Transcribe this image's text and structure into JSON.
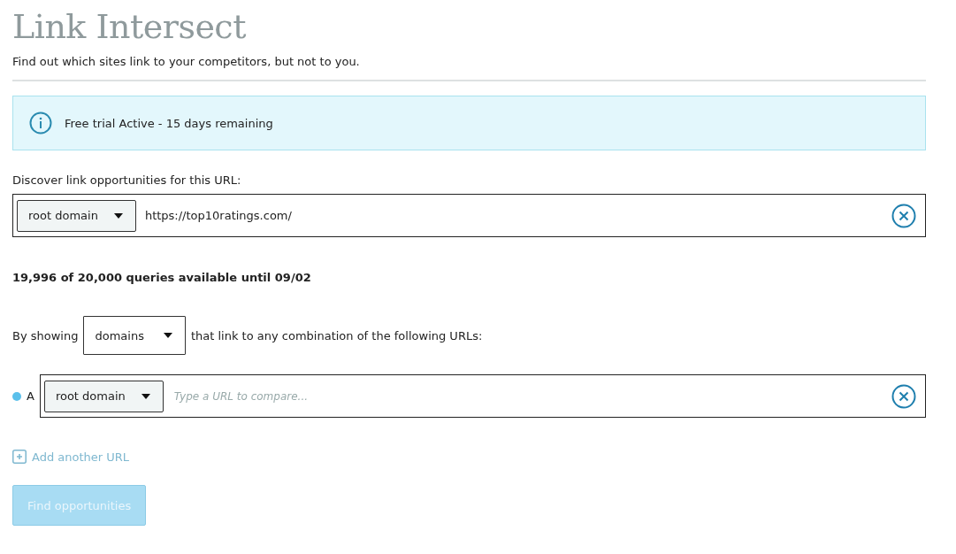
{
  "title": "Link Intersect",
  "subtitle": "Find out which sites link to your competitors, but not to you.",
  "alert": {
    "text": "Free trial Active - 15 days remaining"
  },
  "target": {
    "label": "Discover link opportunities for this URL:",
    "scope": "root domain",
    "value": "https://top10ratings.com/"
  },
  "quota": "19,996 of 20,000 queries available until 09/02",
  "showing": {
    "before": "By showing",
    "choice": "domains",
    "after": "that link to any combination of the following URLs:"
  },
  "competitors": [
    {
      "letter": "A",
      "color": "#5bc0eb",
      "scope": "root domain",
      "placeholder": "Type a URL to compare..."
    }
  ],
  "add_link": "Add another URL",
  "submit": {
    "label": "Find opportunities",
    "disabled": true
  }
}
